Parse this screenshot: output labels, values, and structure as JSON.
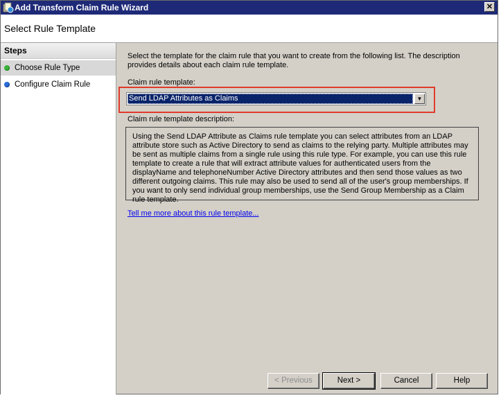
{
  "window": {
    "title": "Add Transform Claim Rule Wizard",
    "close_glyph": "✕",
    "icon": "wizard-app-icon"
  },
  "header": {
    "page_title": "Select Rule Template"
  },
  "sidebar": {
    "steps_title": "Steps",
    "items": [
      {
        "label": "Choose Rule Type",
        "status_color": "#3cb43c",
        "active": true
      },
      {
        "label": "Configure Claim Rule",
        "status_color": "#2a6dd8",
        "active": false
      }
    ]
  },
  "main": {
    "intro": "Select the template for the claim rule that you want to create from the following list. The description provides details about each claim rule template.",
    "template_label": "Claim rule template:",
    "template_selected": "Send LDAP Attributes as Claims",
    "description_label": "Claim rule template description:",
    "description": "Using the Send LDAP Attribute as Claims rule template you can select attributes from an LDAP attribute store such as Active Directory to send as claims to the relying party. Multiple attributes may be sent as multiple claims from a single rule using this rule type. For example, you can use this rule template to create a rule that will extract attribute values for authenticated users from the displayName and telephoneNumber Active Directory attributes and then send those values as two different outgoing claims. This rule may also be used to send all of the user's group memberships. If you want to only send individual group memberships, use the Send Group Membership as a Claim rule template.",
    "help_link": "Tell me more about this rule template..."
  },
  "buttons": {
    "previous": "< Previous",
    "next": "Next >",
    "cancel": "Cancel",
    "help": "Help"
  },
  "colors": {
    "title_bar": "#1e2a78",
    "highlight_border": "#e03a2a",
    "selection": "#0a246a",
    "link": "#0000ee"
  }
}
